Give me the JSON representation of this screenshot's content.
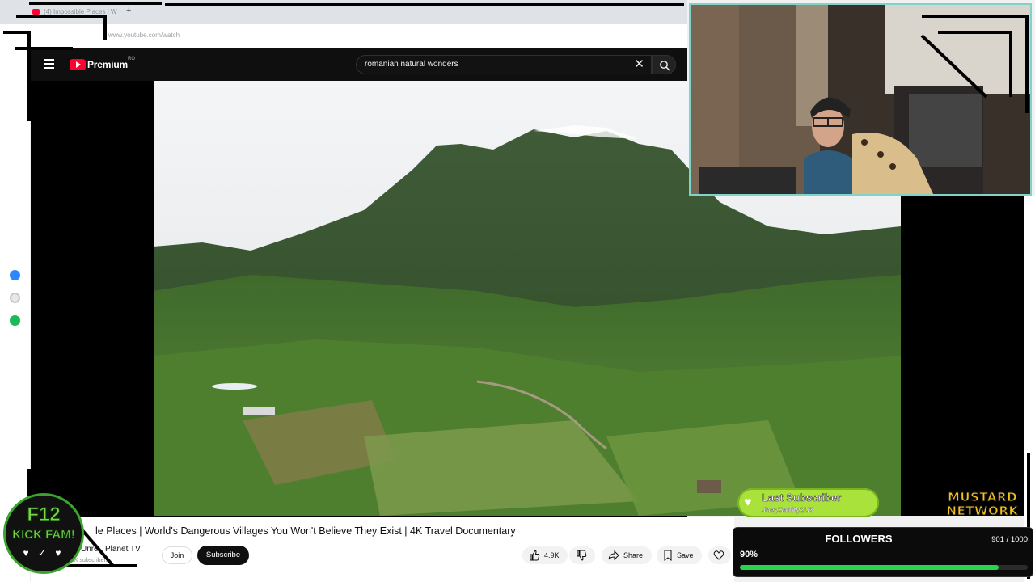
{
  "browser": {
    "tab_title": "(4) Impossible Places | W",
    "newtab_label": "+",
    "url": "www.youtube.com/watch"
  },
  "youtube": {
    "logo_text": "Premium",
    "region": "RO",
    "search_query": "romanian natural wonders",
    "clear_icon": "✕",
    "search_icon": "search-icon"
  },
  "video": {
    "title": "le Places | World's Dangerous Villages You Won't Believe They Exist | 4K Travel Documentary",
    "channel_name": "Unre.. Planet TV",
    "channel_subs": "2K subscribers",
    "join_label": "Join",
    "subscribe_label": "Subscribe",
    "likes": "4.9K",
    "share_label": "Share",
    "save_label": "Save"
  },
  "overlay": {
    "last_subscriber_title": "Last Subscriber",
    "last_subscriber_name": "JheySanity2U3",
    "mustard_line1": "MUSTARD",
    "mustard_line2": "NETWORK",
    "followers_title": "FOLLOWERS",
    "followers_count": "901 / 1000",
    "followers_percent": "90%",
    "followers_progress": 0.9,
    "badge_line1": "F12",
    "badge_line2": "KICK FAM!",
    "badge_icons": "♥ ✓ ♥"
  },
  "colors": {
    "accent_green": "#28d44b",
    "youtube_red": "#ff0033",
    "mustard": "#f6c21a",
    "webcam_border": "#7fd3c8"
  }
}
